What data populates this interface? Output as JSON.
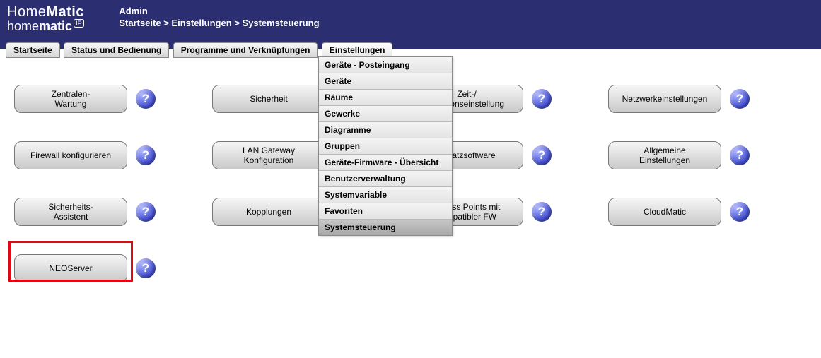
{
  "header": {
    "logo_main_1": "Home",
    "logo_main_2": "Matic",
    "logo_sub_1": "home",
    "logo_sub_2": "matic",
    "ip_badge": "IP",
    "admin": "Admin",
    "breadcrumb": "Startseite > Einstellungen > Systemsteuerung"
  },
  "tabs": {
    "startseite": "Startseite",
    "status": "Status und Bedienung",
    "programme": "Programme und Verknüpfungen",
    "einstellungen": "Einstellungen"
  },
  "buttons": {
    "zentralen": "Zentralen-\nWartung",
    "sicherheit": "Sicherheit",
    "zeit": "Zeit-/\nPositionseinstellung",
    "netzwerk": "Netzwerkeinstellungen",
    "firewall": "Firewall konfigurieren",
    "lan": "LAN Gateway\nKonfiguration",
    "zusatz": "Zusatzsoftware",
    "allgemeine": "Allgemeine\nEinstellungen",
    "sicherheits_assistent": "Sicherheits-\nAssistent",
    "kopplungen": "Kopplungen",
    "accesspoints": "Access Points mit\nkompatibler FW",
    "cloudmatic": "CloudMatic",
    "neoserver": "NEOServer"
  },
  "help_glyph": "?",
  "dropdown": {
    "items": [
      "Geräte - Posteingang",
      "Geräte",
      "Räume",
      "Gewerke",
      "Diagramme",
      "Gruppen",
      "Geräte-Firmware - Übersicht",
      "Benutzerverwaltung",
      "Systemvariable",
      "Favoriten",
      "Systemsteuerung"
    ],
    "active_index": 10
  }
}
